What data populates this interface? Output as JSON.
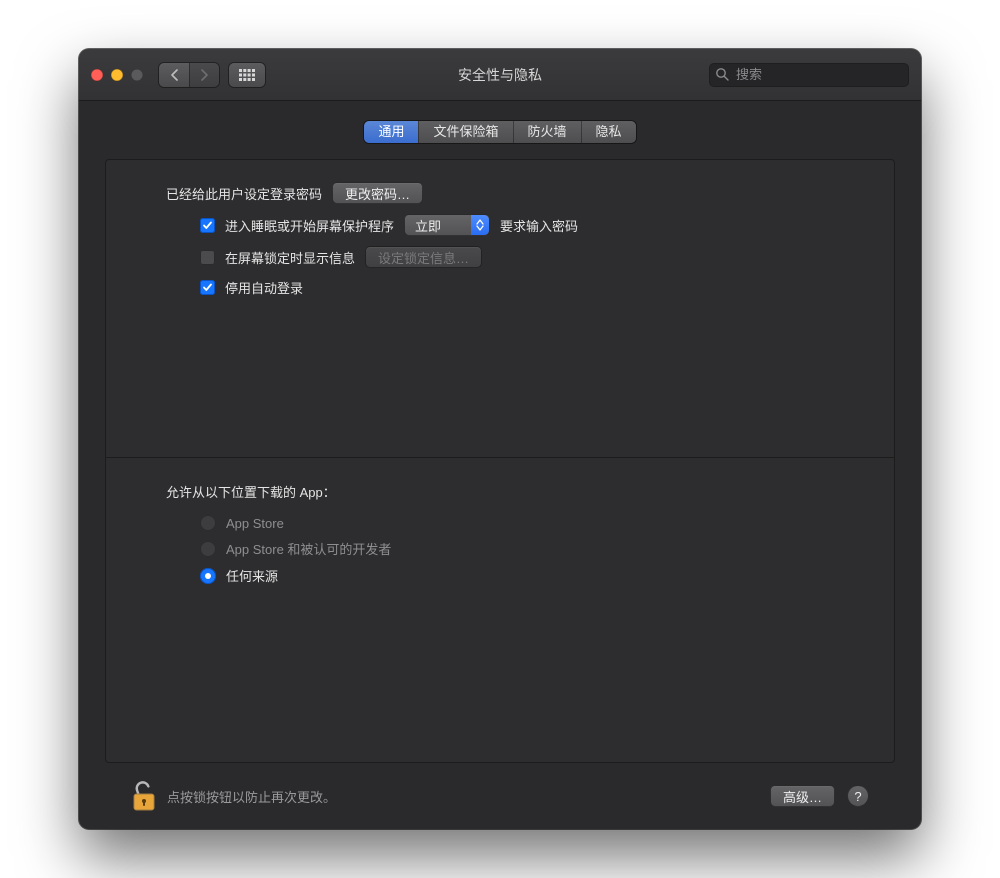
{
  "window": {
    "title": "安全性与隐私"
  },
  "toolbar": {
    "search_placeholder": "搜索"
  },
  "tabs": [
    {
      "id": "general",
      "label": "通用",
      "active": true
    },
    {
      "id": "filevault",
      "label": "文件保险箱",
      "active": false
    },
    {
      "id": "firewall",
      "label": "防火墙",
      "active": false
    },
    {
      "id": "privacy",
      "label": "隐私",
      "active": false
    }
  ],
  "general": {
    "password_set_label": "已经给此用户设定登录密码",
    "change_password_button": "更改密码…",
    "require_password_prefix": "进入睡眠或开始屏幕保护程序",
    "require_password_delay": "立即",
    "require_password_suffix": "要求输入密码",
    "require_password_checked": true,
    "show_lock_message_label": "在屏幕锁定时显示信息",
    "show_lock_message_checked": false,
    "set_lock_message_button": "设定锁定信息…",
    "disable_autologin_label": "停用自动登录",
    "disable_autologin_checked": true
  },
  "gatekeeper": {
    "heading": "允许从以下位置下载的 App：",
    "options": [
      {
        "id": "appstore",
        "label": "App Store",
        "selected": false,
        "disabled": true
      },
      {
        "id": "identified",
        "label": "App Store 和被认可的开发者",
        "selected": false,
        "disabled": true
      },
      {
        "id": "anywhere",
        "label": "任何来源",
        "selected": true,
        "disabled": false
      }
    ]
  },
  "footer": {
    "lock_hint": "点按锁按钮以防止再次更改。",
    "advanced_button": "高级…",
    "help_label": "?"
  }
}
